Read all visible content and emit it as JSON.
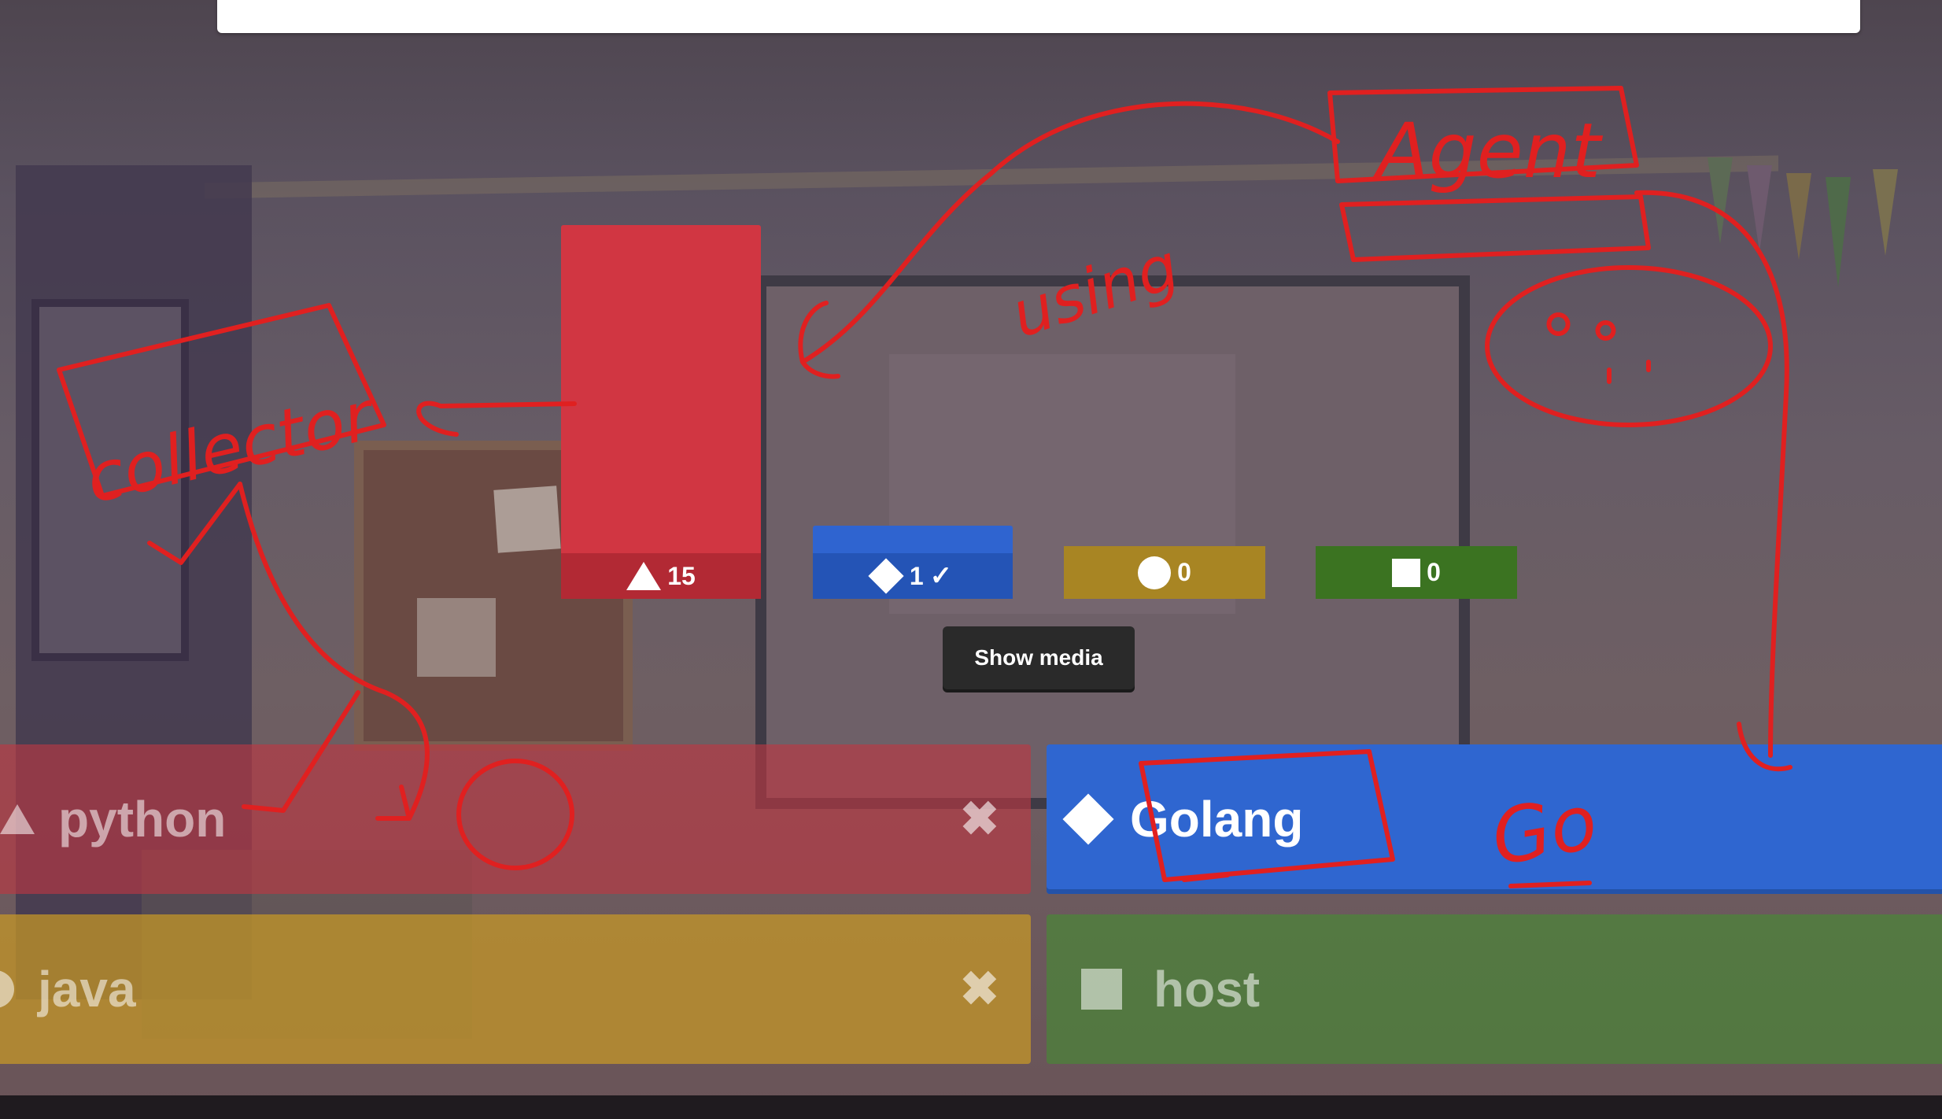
{
  "results": {
    "bars": [
      {
        "shape": "triangle",
        "count": "15",
        "color": "#d13642"
      },
      {
        "shape": "diamond",
        "count": "1",
        "correct_mark": "✓",
        "color": "#2f64d0"
      },
      {
        "shape": "circle",
        "count": "0",
        "color": "#a88523"
      },
      {
        "shape": "square",
        "count": "0",
        "color": "#3b7321"
      }
    ],
    "show_media_label": "Show media"
  },
  "answers": {
    "python": {
      "label": "python",
      "shape": "triangle",
      "mark": "✖",
      "correct": false
    },
    "golang": {
      "label": "Golang",
      "shape": "diamond",
      "correct": true
    },
    "java": {
      "label": "java",
      "shape": "circle",
      "mark": "✖",
      "correct": false
    },
    "host": {
      "label": "host",
      "shape": "square",
      "correct": false
    }
  },
  "annotations": {
    "collector": "collector",
    "agent": "Agent",
    "using": "using",
    "go": "Go"
  }
}
